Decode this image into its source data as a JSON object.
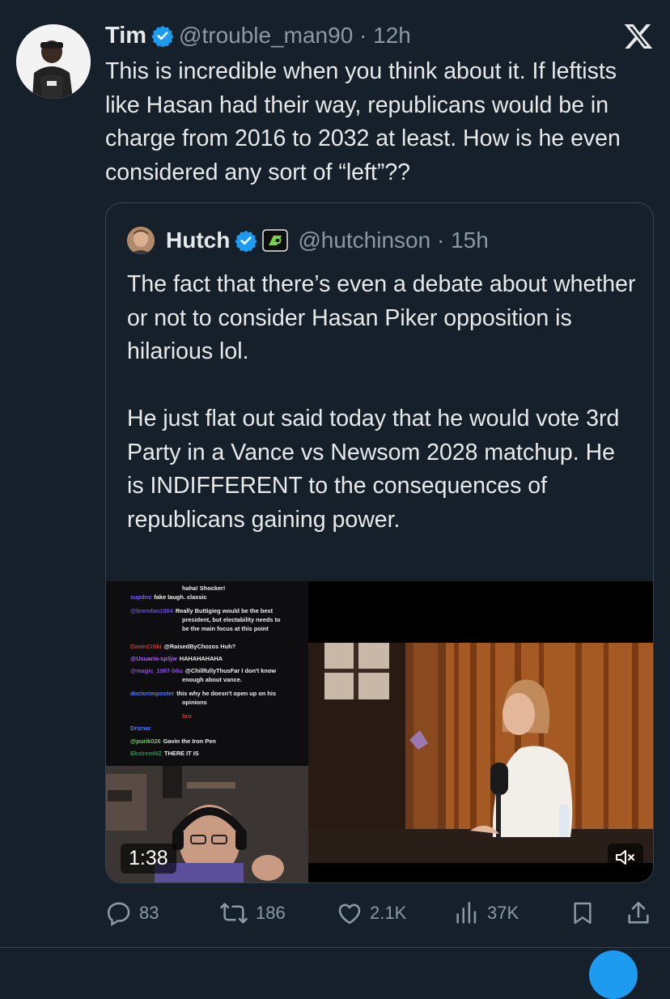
{
  "tweet": {
    "author_name": "Tim",
    "handle_time": "@trouble_man90 · 12h",
    "text": "This is incredible when you think about it. If leftists like Hasan had their way, republicans would be in charge from 2016 to 2032 at least. How is he even considered any sort of “left”??"
  },
  "quote": {
    "author_name": "Hutch",
    "handle_time": "@hutchinson · 15h",
    "paragraph1": "The fact that there’s even a debate about whether or not to consider Hasan Piker opposition is hilarious lol.",
    "paragraph2": "He just flat out said today that he would vote 3rd Party in a Vance vs Newsom 2028 matchup. He is INDIFFERENT to the consequences of republicans gaining power."
  },
  "video": {
    "duration": "1:38",
    "chat": [
      {
        "user": "",
        "msg": "haha! Shocker!",
        "color": "#efeff1"
      },
      {
        "user": "supdns",
        "msg": "fake laugh. classic",
        "color": "#7b5cff"
      },
      {
        "user": "@brendan1904",
        "msg": "Really Buttigieg would be the best",
        "color": "#6a4fd8"
      },
      {
        "user": "",
        "msg": "president, but electability needs to",
        "color": "#efeff1"
      },
      {
        "user": "",
        "msg": "be the main focus at this point",
        "color": "#efeff1"
      },
      {
        "user": "DavinCiSki",
        "msg": "@RaisedByChozos Huh?",
        "color": "#c03a3a"
      },
      {
        "user": "@Usuario-sp3jw",
        "msg": "HAHAHAHAHA",
        "color": "#b65cff"
      },
      {
        "user": "@magic_1987-b6u",
        "msg": "@ChillfullyThusFar I don't know",
        "color": "#8a4fd8"
      },
      {
        "user": "",
        "msg": "enough about vance.",
        "color": "#efeff1"
      },
      {
        "user": "doctorimposter",
        "msg": "this why he doesn't open up on his",
        "color": "#4e7bff"
      },
      {
        "user": "",
        "msg": "opinions",
        "color": "#efeff1"
      },
      {
        "user": "",
        "msg": "bro",
        "color": "#c03a3a"
      },
      {
        "user": "Driznar",
        "msg": "",
        "color": "#4e7bff"
      },
      {
        "user": "@purik026",
        "msg": "Gavin the Iron Pen",
        "color": "#5fd35f"
      },
      {
        "user": "EkstremNZ",
        "msg": "THERE IT IS",
        "color": "#3a8a5a"
      }
    ]
  },
  "actions": {
    "replies": "83",
    "reposts": "186",
    "likes": "2.1K",
    "views": "37K"
  },
  "colors": {
    "background": "#15202b",
    "text": "#e7e9ea",
    "secondary": "#8b98a5",
    "verified": "#1d9bf0",
    "border": "#38444d"
  }
}
